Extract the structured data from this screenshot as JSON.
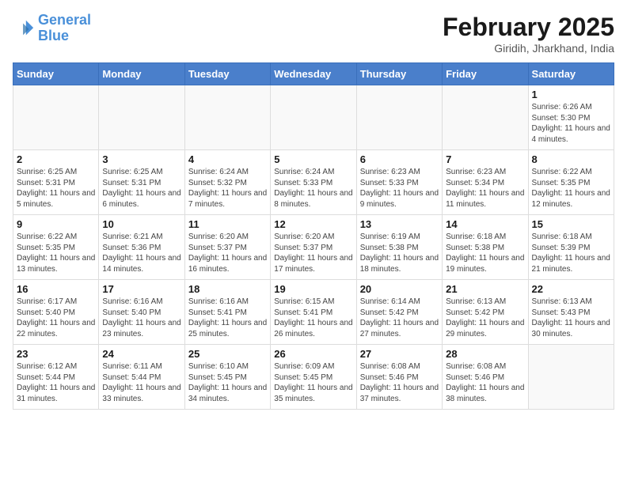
{
  "logo": {
    "line1": "General",
    "line2": "Blue"
  },
  "title": "February 2025",
  "location": "Giridih, Jharkhand, India",
  "days_of_week": [
    "Sunday",
    "Monday",
    "Tuesday",
    "Wednesday",
    "Thursday",
    "Friday",
    "Saturday"
  ],
  "weeks": [
    [
      {
        "day": "",
        "info": ""
      },
      {
        "day": "",
        "info": ""
      },
      {
        "day": "",
        "info": ""
      },
      {
        "day": "",
        "info": ""
      },
      {
        "day": "",
        "info": ""
      },
      {
        "day": "",
        "info": ""
      },
      {
        "day": "1",
        "info": "Sunrise: 6:26 AM\nSunset: 5:30 PM\nDaylight: 11 hours and 4 minutes."
      }
    ],
    [
      {
        "day": "2",
        "info": "Sunrise: 6:25 AM\nSunset: 5:31 PM\nDaylight: 11 hours and 5 minutes."
      },
      {
        "day": "3",
        "info": "Sunrise: 6:25 AM\nSunset: 5:31 PM\nDaylight: 11 hours and 6 minutes."
      },
      {
        "day": "4",
        "info": "Sunrise: 6:24 AM\nSunset: 5:32 PM\nDaylight: 11 hours and 7 minutes."
      },
      {
        "day": "5",
        "info": "Sunrise: 6:24 AM\nSunset: 5:33 PM\nDaylight: 11 hours and 8 minutes."
      },
      {
        "day": "6",
        "info": "Sunrise: 6:23 AM\nSunset: 5:33 PM\nDaylight: 11 hours and 9 minutes."
      },
      {
        "day": "7",
        "info": "Sunrise: 6:23 AM\nSunset: 5:34 PM\nDaylight: 11 hours and 11 minutes."
      },
      {
        "day": "8",
        "info": "Sunrise: 6:22 AM\nSunset: 5:35 PM\nDaylight: 11 hours and 12 minutes."
      }
    ],
    [
      {
        "day": "9",
        "info": "Sunrise: 6:22 AM\nSunset: 5:35 PM\nDaylight: 11 hours and 13 minutes."
      },
      {
        "day": "10",
        "info": "Sunrise: 6:21 AM\nSunset: 5:36 PM\nDaylight: 11 hours and 14 minutes."
      },
      {
        "day": "11",
        "info": "Sunrise: 6:20 AM\nSunset: 5:37 PM\nDaylight: 11 hours and 16 minutes."
      },
      {
        "day": "12",
        "info": "Sunrise: 6:20 AM\nSunset: 5:37 PM\nDaylight: 11 hours and 17 minutes."
      },
      {
        "day": "13",
        "info": "Sunrise: 6:19 AM\nSunset: 5:38 PM\nDaylight: 11 hours and 18 minutes."
      },
      {
        "day": "14",
        "info": "Sunrise: 6:18 AM\nSunset: 5:38 PM\nDaylight: 11 hours and 19 minutes."
      },
      {
        "day": "15",
        "info": "Sunrise: 6:18 AM\nSunset: 5:39 PM\nDaylight: 11 hours and 21 minutes."
      }
    ],
    [
      {
        "day": "16",
        "info": "Sunrise: 6:17 AM\nSunset: 5:40 PM\nDaylight: 11 hours and 22 minutes."
      },
      {
        "day": "17",
        "info": "Sunrise: 6:16 AM\nSunset: 5:40 PM\nDaylight: 11 hours and 23 minutes."
      },
      {
        "day": "18",
        "info": "Sunrise: 6:16 AM\nSunset: 5:41 PM\nDaylight: 11 hours and 25 minutes."
      },
      {
        "day": "19",
        "info": "Sunrise: 6:15 AM\nSunset: 5:41 PM\nDaylight: 11 hours and 26 minutes."
      },
      {
        "day": "20",
        "info": "Sunrise: 6:14 AM\nSunset: 5:42 PM\nDaylight: 11 hours and 27 minutes."
      },
      {
        "day": "21",
        "info": "Sunrise: 6:13 AM\nSunset: 5:42 PM\nDaylight: 11 hours and 29 minutes."
      },
      {
        "day": "22",
        "info": "Sunrise: 6:13 AM\nSunset: 5:43 PM\nDaylight: 11 hours and 30 minutes."
      }
    ],
    [
      {
        "day": "23",
        "info": "Sunrise: 6:12 AM\nSunset: 5:44 PM\nDaylight: 11 hours and 31 minutes."
      },
      {
        "day": "24",
        "info": "Sunrise: 6:11 AM\nSunset: 5:44 PM\nDaylight: 11 hours and 33 minutes."
      },
      {
        "day": "25",
        "info": "Sunrise: 6:10 AM\nSunset: 5:45 PM\nDaylight: 11 hours and 34 minutes."
      },
      {
        "day": "26",
        "info": "Sunrise: 6:09 AM\nSunset: 5:45 PM\nDaylight: 11 hours and 35 minutes."
      },
      {
        "day": "27",
        "info": "Sunrise: 6:08 AM\nSunset: 5:46 PM\nDaylight: 11 hours and 37 minutes."
      },
      {
        "day": "28",
        "info": "Sunrise: 6:08 AM\nSunset: 5:46 PM\nDaylight: 11 hours and 38 minutes."
      },
      {
        "day": "",
        "info": ""
      }
    ]
  ]
}
